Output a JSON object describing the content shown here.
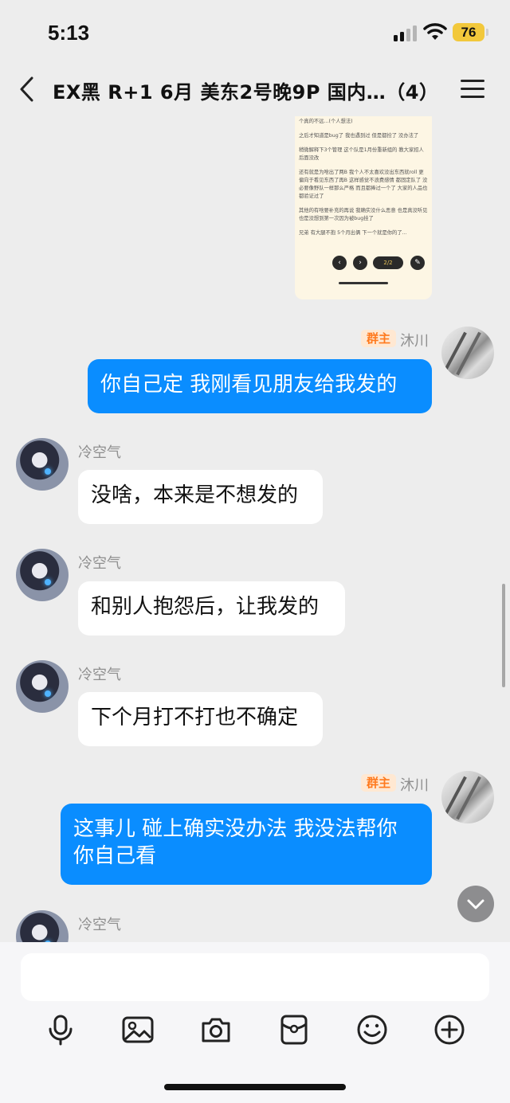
{
  "status": {
    "time": "5:13",
    "battery": "76"
  },
  "header": {
    "title": "EX黑 R+1 6月 美东2号晚9P 国内…（4）"
  },
  "screenshot": {
    "lines": [
      "个真的不远...(个人想法)",
      "之后才知道是bug了 我也遇到过 但是都捡了 没办法了",
      "稍微解释下3个管理 这个队是1月份重新组的 教大家招人 后面没改",
      "还有就是为啥出了两B 我个人不太喜欢没出东西就roll 更偏向于看见东西了再B 这样感觉不浪费感情 都固定队了 没必要像野队一样那么严格 而且都捧过一个了 大家的人品也都验证过了",
      "其他的有啥要补充的再说 我确实没什么恶意 也是真没听见 也是没想到第一次因为被bug挂了",
      "兄弟 有大腿不抱 5个月出俩 下一个就是你的了..."
    ],
    "page": "2/2"
  },
  "messages": [
    {
      "id": "m1",
      "sender": "沐川",
      "badge": "群主",
      "text": "你自己定 我刚看见朋友给我发的"
    },
    {
      "id": "m2",
      "sender": "冷空气",
      "text": "没啥，本来是不想发的"
    },
    {
      "id": "m3",
      "sender": "冷空气",
      "text": "和别人抱怨后，让我发的"
    },
    {
      "id": "m4",
      "sender": "冷空气",
      "text": "下个月打不打也不确定"
    },
    {
      "id": "m5",
      "sender": "沐川",
      "badge": "群主",
      "text_line1": "这事儿 碰上确实没办法 我没法帮你",
      "text_line2": "你自己看"
    },
    {
      "id": "m6",
      "sender": "冷空气"
    }
  ],
  "toolbar": {
    "icons": [
      "microphone-icon",
      "image-icon",
      "camera-icon",
      "red-packet-icon",
      "emoji-icon",
      "plus-icon"
    ]
  },
  "colors": {
    "my_bubble": "#0a8dff",
    "their_bubble": "#ffffff",
    "owner_badge": "#ff7a1e",
    "background": "#ededed"
  }
}
